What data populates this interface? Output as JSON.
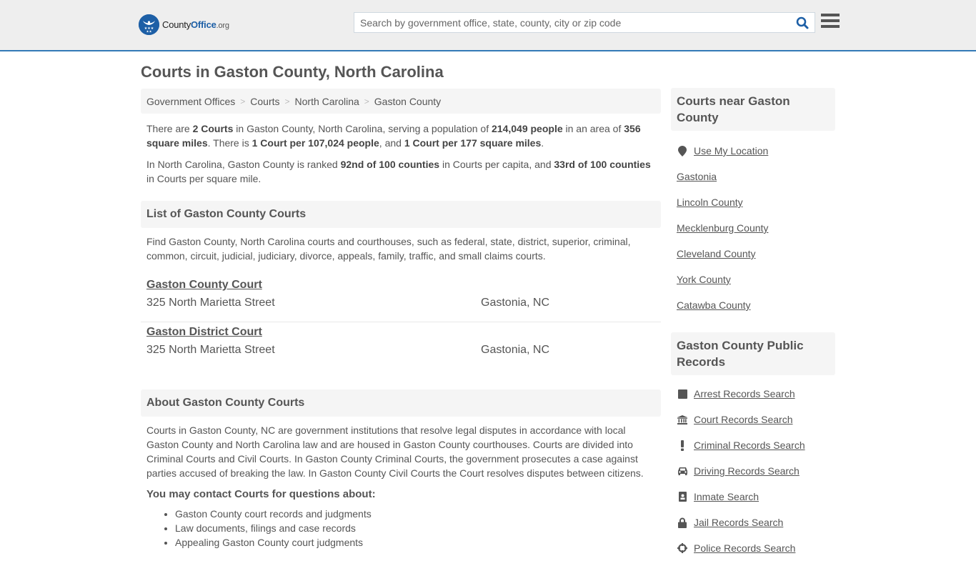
{
  "header": {
    "logo": {
      "county": "County",
      "office": "Office",
      "org": ".org"
    },
    "search": {
      "placeholder": "Search by government office, state, county, city or zip code",
      "value": ""
    }
  },
  "page_title": "Courts in Gaston County, North Carolina",
  "breadcrumb": [
    {
      "label": "Government Offices"
    },
    {
      "label": "Courts"
    },
    {
      "label": "North Carolina"
    },
    {
      "label": "Gaston County"
    }
  ],
  "intro": {
    "p1": {
      "t1": "There are ",
      "b1": "2 Courts",
      "t2": " in Gaston County, North Carolina, serving a population of ",
      "b2": "214,049 people",
      "t3": " in an area of ",
      "b3": "356 square miles",
      "t4": ". There is ",
      "b4": "1 Court per 107,024 people",
      "t5": ", and ",
      "b5": "1 Court per 177 square miles",
      "t6": "."
    },
    "p2": {
      "t1": "In North Carolina, Gaston County is ranked ",
      "b1": "92nd of 100 counties",
      "t2": " in Courts per capita, and ",
      "b2": "33rd of 100 counties",
      "t3": " in Courts per square mile."
    }
  },
  "list_section": {
    "heading": "List of Gaston County Courts",
    "description": "Find Gaston County, North Carolina courts and courthouses, such as federal, state, district, superior, criminal, common, circuit, judicial, judiciary, divorce, appeals, family, traffic, and small claims courts.",
    "courts": [
      {
        "name": "Gaston County Court",
        "address": "325 North Marietta Street",
        "city": "Gastonia, NC"
      },
      {
        "name": "Gaston District Court",
        "address": "325 North Marietta Street",
        "city": "Gastonia, NC"
      }
    ]
  },
  "about_section": {
    "heading": "About Gaston County Courts",
    "text": "Courts in Gaston County, NC are government institutions that resolve legal disputes in accordance with local Gaston County and North Carolina law and are housed in Gaston County courthouses. Courts are divided into Criminal Courts and Civil Courts. In Gaston County Criminal Courts, the government prosecutes a case against parties accused of breaking the law. In Gaston County Civil Courts the Court resolves disputes between citizens.",
    "contact_heading": "You may contact Courts for questions about:",
    "bullets": [
      "Gaston County court records and judgments",
      "Law documents, filings and case records",
      "Appealing Gaston County court judgments"
    ]
  },
  "sidebar": {
    "near": {
      "heading": "Courts near Gaston County",
      "use_location": {
        "label": "Use My Location",
        "icon": "map-marker-icon"
      },
      "items": [
        "Gastonia",
        "Lincoln County",
        "Mecklenburg County",
        "Cleveland County",
        "York County",
        "Catawba County"
      ]
    },
    "records": {
      "heading": "Gaston County Public Records",
      "items": [
        {
          "label": "Arrest Records Search",
          "icon": "square-icon"
        },
        {
          "label": "Court Records Search",
          "icon": "courthouse-icon"
        },
        {
          "label": "Criminal Records Search",
          "icon": "exclamation-icon"
        },
        {
          "label": "Driving Records Search",
          "icon": "car-icon"
        },
        {
          "label": "Inmate Search",
          "icon": "id-badge-icon"
        },
        {
          "label": "Jail Records Search",
          "icon": "lock-icon"
        },
        {
          "label": "Police Records Search",
          "icon": "crosshairs-icon"
        }
      ]
    }
  },
  "colors": {
    "brand_blue": "#1d5fa6",
    "header_border": "#337ab7",
    "panel_bg": "#f5f5f5",
    "text": "#555555"
  }
}
